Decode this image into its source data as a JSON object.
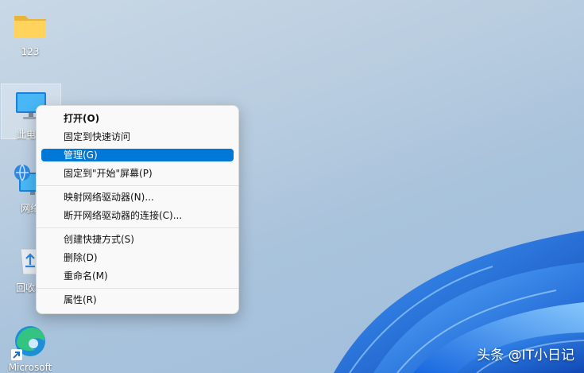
{
  "desktop": {
    "icons": [
      {
        "label": "123",
        "icon": "folder-icon"
      },
      {
        "label": "此电脑",
        "icon": "monitor-icon"
      },
      {
        "label": "网络",
        "icon": "network-icon"
      },
      {
        "label": "回收站",
        "icon": "recycle-bin-icon"
      },
      {
        "label": "Microsoft",
        "icon": "edge-icon"
      }
    ]
  },
  "context_menu": {
    "groups": [
      [
        {
          "label": "打开(O)",
          "bold": true
        },
        {
          "label": "固定到快速访问"
        },
        {
          "label": "管理(G)",
          "highlighted": true
        },
        {
          "label": "固定到\"开始\"屏幕(P)"
        }
      ],
      [
        {
          "label": "映射网络驱动器(N)..."
        },
        {
          "label": "断开网络驱动器的连接(C)..."
        }
      ],
      [
        {
          "label": "创建快捷方式(S)"
        },
        {
          "label": "删除(D)"
        },
        {
          "label": "重命名(M)"
        }
      ],
      [
        {
          "label": "属性(R)"
        }
      ]
    ]
  },
  "watermark": "头条 @IT小日记",
  "colors": {
    "menu_highlight": "#0078d7",
    "menu_background": "#f9f9f9",
    "wallpaper_blue": "#1a6fe0"
  }
}
